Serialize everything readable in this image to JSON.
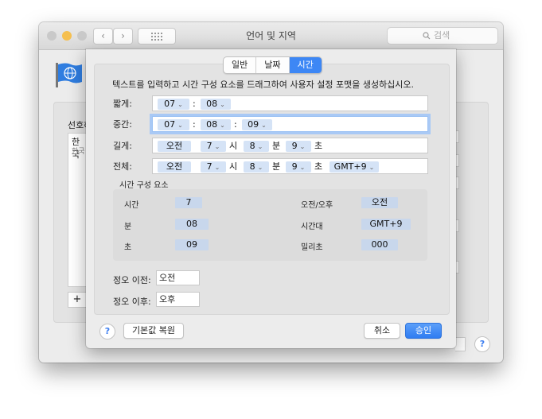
{
  "window": {
    "title": "언어 및 지역",
    "search_placeholder": "검색",
    "sidebar_heading": "선호하",
    "list_item_main": "한국",
    "list_item_sub": "한국",
    "add_label": "+"
  },
  "sheet": {
    "tabs": [
      {
        "label": "일반",
        "selected": false
      },
      {
        "label": "날짜",
        "selected": false
      },
      {
        "label": "시간",
        "selected": true
      }
    ],
    "instruction": "텍스트를 입력하고 시간 구성 요소를 드래그하여 사용자 설정 포맷을 생성하십시오.",
    "rows": {
      "short": {
        "label": "짧게:",
        "tokens": [
          "07",
          "08"
        ],
        "seps": [
          ":"
        ]
      },
      "medium": {
        "label": "중간:",
        "tokens": [
          "07",
          "08",
          "09"
        ],
        "seps": [
          ":",
          ":"
        ]
      },
      "long": {
        "label": "길게:",
        "tokens": [
          "오전",
          "7",
          "8",
          "9"
        ],
        "seps": [
          "시",
          "분",
          "초"
        ]
      },
      "full": {
        "label": "전체:",
        "tokens": [
          "오전",
          "7",
          "8",
          "9",
          "GMT+9"
        ],
        "seps": [
          "시",
          "분",
          "초"
        ]
      }
    },
    "components": {
      "title": "시간 구성 요소",
      "hour_label": "시간",
      "hour_value": "7",
      "minute_label": "분",
      "minute_value": "08",
      "second_label": "초",
      "second_value": "09",
      "ampm_label": "오전/오후",
      "ampm_value": "오전",
      "timezone_label": "시간대",
      "timezone_value": "GMT+9",
      "ms_label": "밀리초",
      "ms_value": "000"
    },
    "before_noon_label": "정오 이전:",
    "before_noon_value": "오전",
    "after_noon_label": "정오 이후:",
    "after_noon_value": "오후",
    "help_label": "?",
    "restore_label": "기본값 복원",
    "cancel_label": "취소",
    "ok_label": "승인"
  },
  "colors": {
    "accent": "#3d87f5",
    "token_bg": "#d5e3f6",
    "focus_ring": "#a9c9f5"
  }
}
